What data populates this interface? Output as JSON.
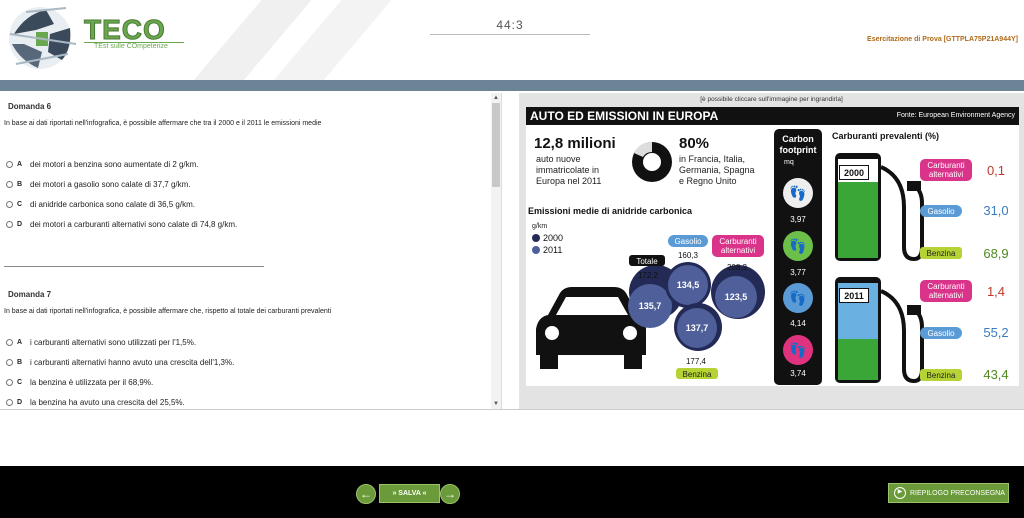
{
  "header": {
    "logo_text": "TECO",
    "logo_subtitle": "TEst sulle COmpetenze",
    "timer": "44:3",
    "exam_code": "Esercitazione di Prova [GTTPLA75P21A944Y]"
  },
  "questions": [
    {
      "title": "Domanda 6",
      "stem": "In base ai dati riportati nell'infografica, è possibile affermare che tra il 2000 e il 2011 le emissioni medie",
      "options": [
        {
          "letter": "A",
          "text": "dei motori a benzina sono aumentate di 2 g/km."
        },
        {
          "letter": "B",
          "text": "dei motori a gasolio sono calate di 37,7 g/km."
        },
        {
          "letter": "C",
          "text": "di anidride carbonica sono calate di 36,5 g/km."
        },
        {
          "letter": "D",
          "text": "dei motori a carburanti alternativi sono calate di 74,8 g/km."
        }
      ]
    },
    {
      "title": "Domanda 7",
      "stem": "In base ai dati riportati nell'infografica, è possibile affermare che, rispetto al totale dei carburanti prevalenti",
      "options": [
        {
          "letter": "A",
          "text": "i carburanti alternativi sono utilizzati per l'1,5%."
        },
        {
          "letter": "B",
          "text": "i carburanti alternativi hanno avuto una crescita dell'1,3%."
        },
        {
          "letter": "C",
          "text": "la benzina è utilizzata per il 68,9%."
        },
        {
          "letter": "D",
          "text": "la benzina ha avuto una crescita del 25,5%."
        }
      ]
    }
  ],
  "infographic": {
    "hint": "[è possibile cliccare sull'immagine per ingrandirla]",
    "title": "AUTO ED EMISSIONI IN EUROPA",
    "source": "Fonte: European Environment Agency",
    "stat1_value": "12,8 milioni",
    "stat1_text": [
      "auto nuove",
      "immatricolate in",
      "Europa nel 2011"
    ],
    "stat2_value": "80%",
    "stat2_text": [
      "in Francia, Italia,",
      "Germania, Spagna",
      "e Regno Unito"
    ],
    "carbon_title": [
      "Carbon",
      "footprint",
      "mq"
    ],
    "carbon_values": [
      "3,97",
      "3,77",
      "4,14",
      "3,74"
    ],
    "fuel_title": "Carburanti prevalenti (%)",
    "emissions_title": "Emissioni medie di anidride carbonica",
    "emissions_unit": "g/km",
    "legend": [
      "2000",
      "2011"
    ],
    "labels": {
      "totale": "Totale",
      "gasolio": "Gasolio",
      "alternativi": [
        "Carburanti",
        "alternativi"
      ],
      "benzina": "Benzina"
    },
    "circles_2000": {
      "totale": "172,2",
      "gasolio": "160,3",
      "alternativi": "208,3",
      "benzina": "177,4"
    },
    "circles_2011": {
      "totale": "135,7",
      "gasolio": "134,5",
      "alternativi": "123,5",
      "benzina": "137,7"
    },
    "fuel_years": [
      {
        "year": "2000",
        "alternativi": "0,1",
        "gasolio": "31,0",
        "benzina": "68,9"
      },
      {
        "year": "2011",
        "alternativi": "1,4",
        "gasolio": "55,2",
        "benzina": "43,4"
      }
    ],
    "fuel_labels": {
      "alternativi": [
        "Carburanti",
        "alternativi"
      ],
      "gasolio": "Gasolio",
      "benzina": "Benzina"
    }
  },
  "footer": {
    "save_label": "» SALVA «",
    "recap_label": "RIEPILOGO PRECONSEGNA"
  },
  "colors": {
    "accent_green": "#6a9a3a",
    "header_bar": "#6b8596",
    "navy": "#3d4a7a",
    "value_red": "#c0392b",
    "value_blue": "#3b7bbf",
    "value_green": "#4f8a1f"
  }
}
